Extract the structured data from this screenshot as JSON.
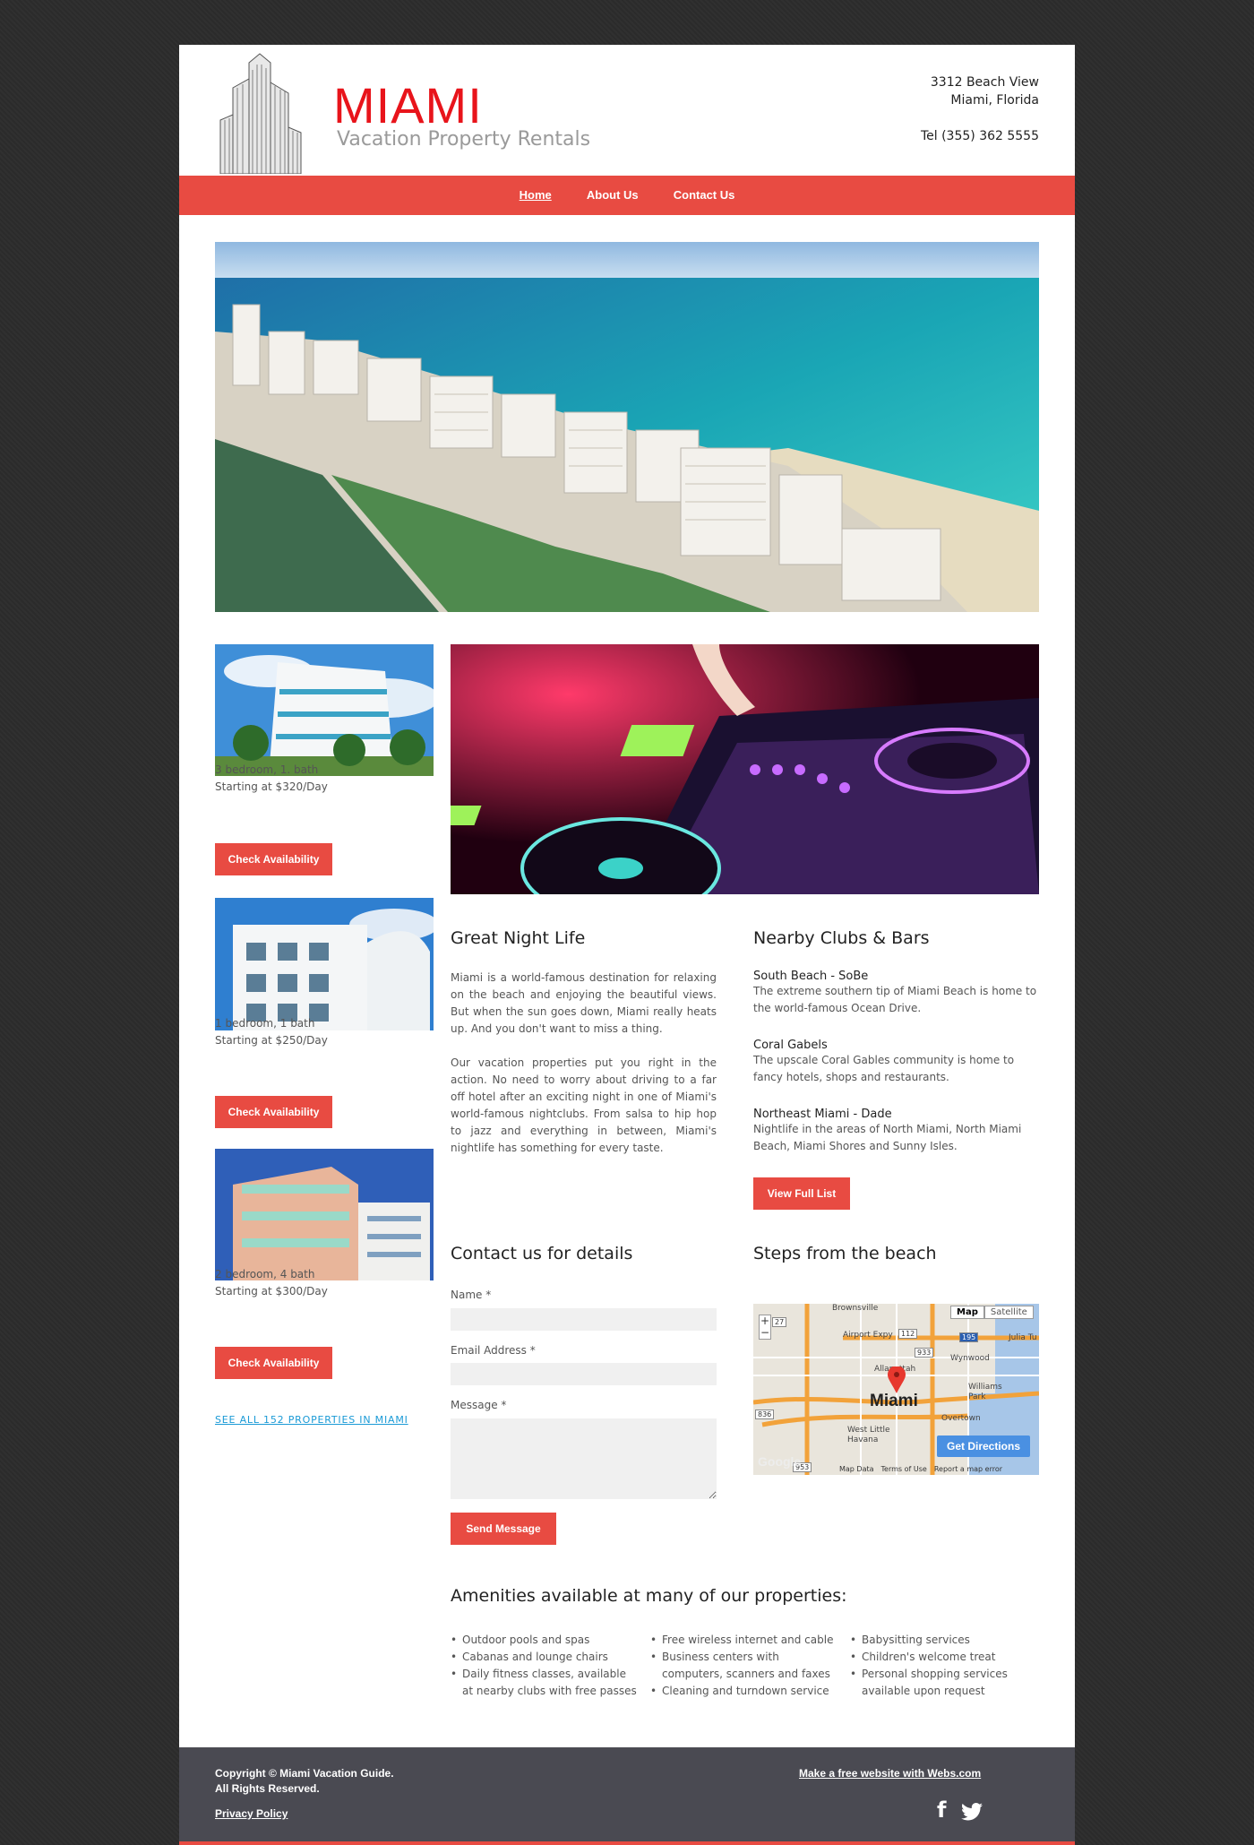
{
  "header": {
    "brand_title": "MIAMI",
    "brand_subtitle": "Vacation Property Rentals",
    "address_line1": "3312 Beach View",
    "address_line2": "Miami, Florida",
    "phone": "Tel  (355) 362 5555"
  },
  "nav": {
    "items": [
      {
        "label": "Home",
        "active": true
      },
      {
        "label": "About Us",
        "active": false
      },
      {
        "label": "Contact Us",
        "active": false
      }
    ]
  },
  "properties": [
    {
      "line1": "3 bedroom, 1. bath",
      "line2": "Starting at $320/Day",
      "button": "Check Availability"
    },
    {
      "line1": "1 bedroom, 1 bath",
      "line2": "Starting at $250/Day",
      "button": "Check Availability"
    },
    {
      "line1": "2 bedroom, 4 bath",
      "line2": "Starting at $300/Day",
      "button": "Check Availability"
    }
  ],
  "see_all_link": "SEE ALL 152 PROPERTIES IN MIAMI",
  "nightlife": {
    "heading": "Great Night Life",
    "para1": "Miami is a world-famous destination for relaxing on the beach and enjoying the beautiful views. But when the sun goes down, Miami really heats up. And you don't want to miss a thing.",
    "para2": "Our vacation properties put you right in the action. No need to worry about driving to a far off hotel after an exciting night in one of Miami's world-famous nightclubs. From salsa to hip hop to jazz and everything in between, Miami's nightlife has something for every taste."
  },
  "clubs": {
    "heading": "Nearby Clubs & Bars",
    "items": [
      {
        "name": "South Beach - SoBe",
        "desc": "The extreme southern tip of Miami Beach is home to the world-famous Ocean Drive."
      },
      {
        "name": "Coral Gabels",
        "desc": "The upscale Coral Gables community is home to fancy hotels, shops and restaurants."
      },
      {
        "name": "Northeast Miami - Dade",
        "desc": "Nightlife in the areas of North Miami, North Miami Beach, Miami Shores and Sunny Isles."
      }
    ],
    "button": "View Full List"
  },
  "contact": {
    "heading": "Contact us for details",
    "name_label": "Name *",
    "email_label": "Email Address *",
    "message_label": "Message *",
    "send_button": "Send Message"
  },
  "map": {
    "heading": "Steps from the beach",
    "map_btn": "Map",
    "satellite_btn": "Satellite",
    "city_label": "Miami",
    "directions_button": "Get Directions",
    "labels": [
      "Brownsville",
      "Airport Expy",
      "Wynwood",
      "Allapattah",
      "Williams Park",
      "Overtown",
      "West Little Havana",
      "Julia Tu"
    ],
    "shields": [
      "27",
      "112",
      "195",
      "933",
      "836",
      "953"
    ],
    "google": "Google",
    "map_data": "Map Data",
    "terms": "Terms of Use",
    "report": "Report a map error"
  },
  "amenities": {
    "heading": "Amenities available at many of our properties:",
    "col1": [
      "Outdoor pools and spas",
      "Cabanas and lounge chairs",
      "Daily fitness classes, available at nearby clubs with free passes"
    ],
    "col2": [
      "Free wireless internet and cable",
      "Business centers with computers, scanners and faxes",
      "Cleaning and turndown service"
    ],
    "col3": [
      "Babysitting services",
      "Children's welcome treat",
      "Personal shopping services available upon request"
    ]
  },
  "footer": {
    "copyright": "Copyright © Miami Vacation Guide.",
    "rights": "All Rights Reserved.",
    "privacy": "Privacy Policy",
    "webs_link": "Make a free website with Webs.com",
    "facebook": "f"
  },
  "colors": {
    "accent": "#e84b42",
    "brand_red": "#e8141b",
    "link": "#1a9ad6",
    "footer_bg": "#4a4a52"
  }
}
